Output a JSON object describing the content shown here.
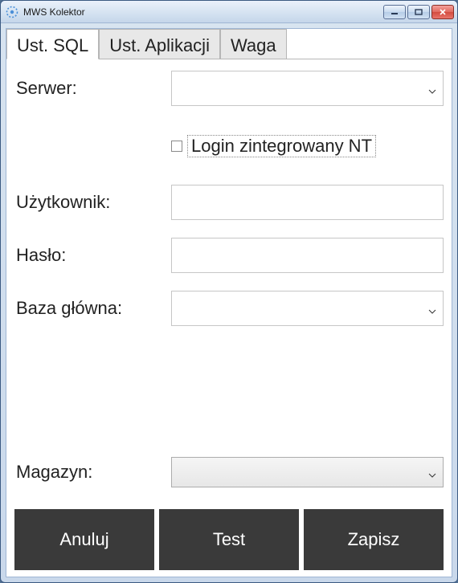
{
  "window": {
    "title": "MWS Kolektor"
  },
  "tabs": {
    "sql": "Ust. SQL",
    "app": "Ust. Aplikacji",
    "waga": "Waga"
  },
  "form": {
    "server_label": "Serwer:",
    "server_value": "",
    "nt_login_label": "Login zintegrowany NT",
    "user_label": "Użytkownik:",
    "user_value": "",
    "password_label": "Hasło:",
    "password_value": "",
    "maindb_label": "Baza główna:",
    "maindb_value": "",
    "warehouse_label": "Magazyn:",
    "warehouse_value": ""
  },
  "buttons": {
    "cancel": "Anuluj",
    "test": "Test",
    "save": "Zapisz"
  }
}
